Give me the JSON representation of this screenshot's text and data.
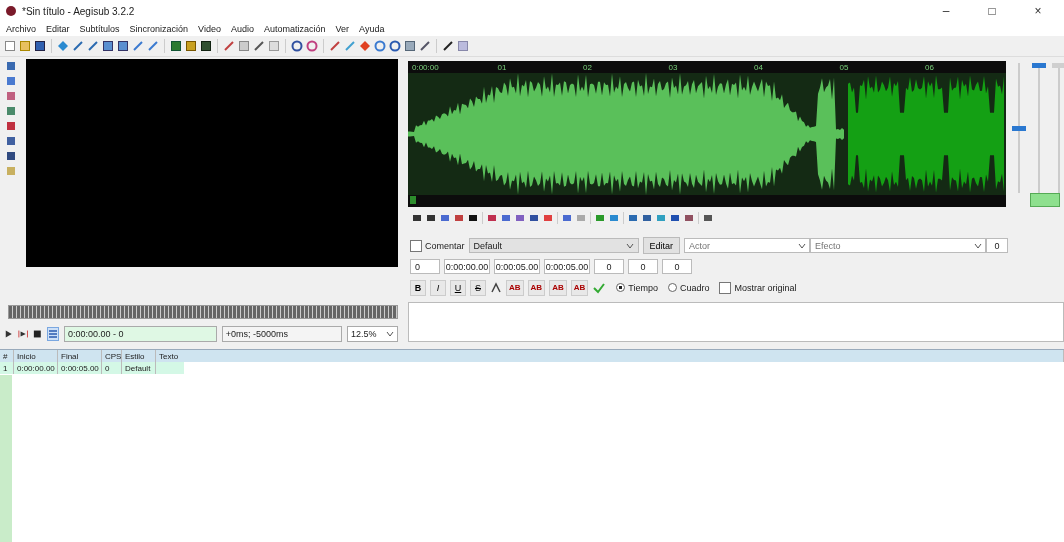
{
  "window": {
    "title": "*Sin título - Aegisub 3.2.2",
    "controls": [
      "–",
      "□",
      "×"
    ]
  },
  "menu": [
    "Archivo",
    "Editar",
    "Subtítulos",
    "Sincronización",
    "Video",
    "Audio",
    "Automatización",
    "Ver",
    "Ayuda"
  ],
  "video": {
    "time": "0:00:00.00 - 0",
    "offset": "+0ms; -5000ms",
    "zoom": "12.5%",
    "autoscroll": {
      "selected": true
    }
  },
  "audio": {
    "ruler": [
      "0:00:00",
      "01",
      "02",
      "03",
      "04",
      "05",
      "06"
    ],
    "sliders": [
      {
        "level": 0.5,
        "disabled": false
      },
      {
        "level": 1,
        "disabled": false
      },
      {
        "level": 1,
        "disabled": true
      }
    ]
  },
  "edit_box": {
    "comment": {
      "label": "Comentar",
      "checked": false
    },
    "style": "Default",
    "edit_button": "Editar",
    "actor": {
      "placeholder": "Actor"
    },
    "effect": {
      "placeholder": "Efecto"
    },
    "count": "0",
    "layer": "0",
    "start": "0:00:00.00",
    "end": "0:00:05.00",
    "duration": "0:00:05.00",
    "margins": [
      "0",
      "0",
      "0"
    ],
    "format_buttons": [
      "B",
      "I",
      "U",
      "S"
    ],
    "color_buttons": [
      "AB",
      "AB",
      "AB",
      "AB"
    ],
    "time_mode": [
      {
        "label": "Tiempo",
        "selected": true
      },
      {
        "label": "Cuadro",
        "selected": false
      }
    ],
    "show_original": {
      "label": "Mostrar original",
      "checked": false
    }
  },
  "grid": {
    "columns": [
      "#",
      "Inicio",
      "Final",
      "CPS",
      "Estilo",
      "Texto"
    ],
    "rows": [
      {
        "cells": [
          "1",
          "0:00:00.00",
          "0:00:05.00",
          "0",
          "Default",
          ""
        ],
        "selected": true
      }
    ]
  }
}
